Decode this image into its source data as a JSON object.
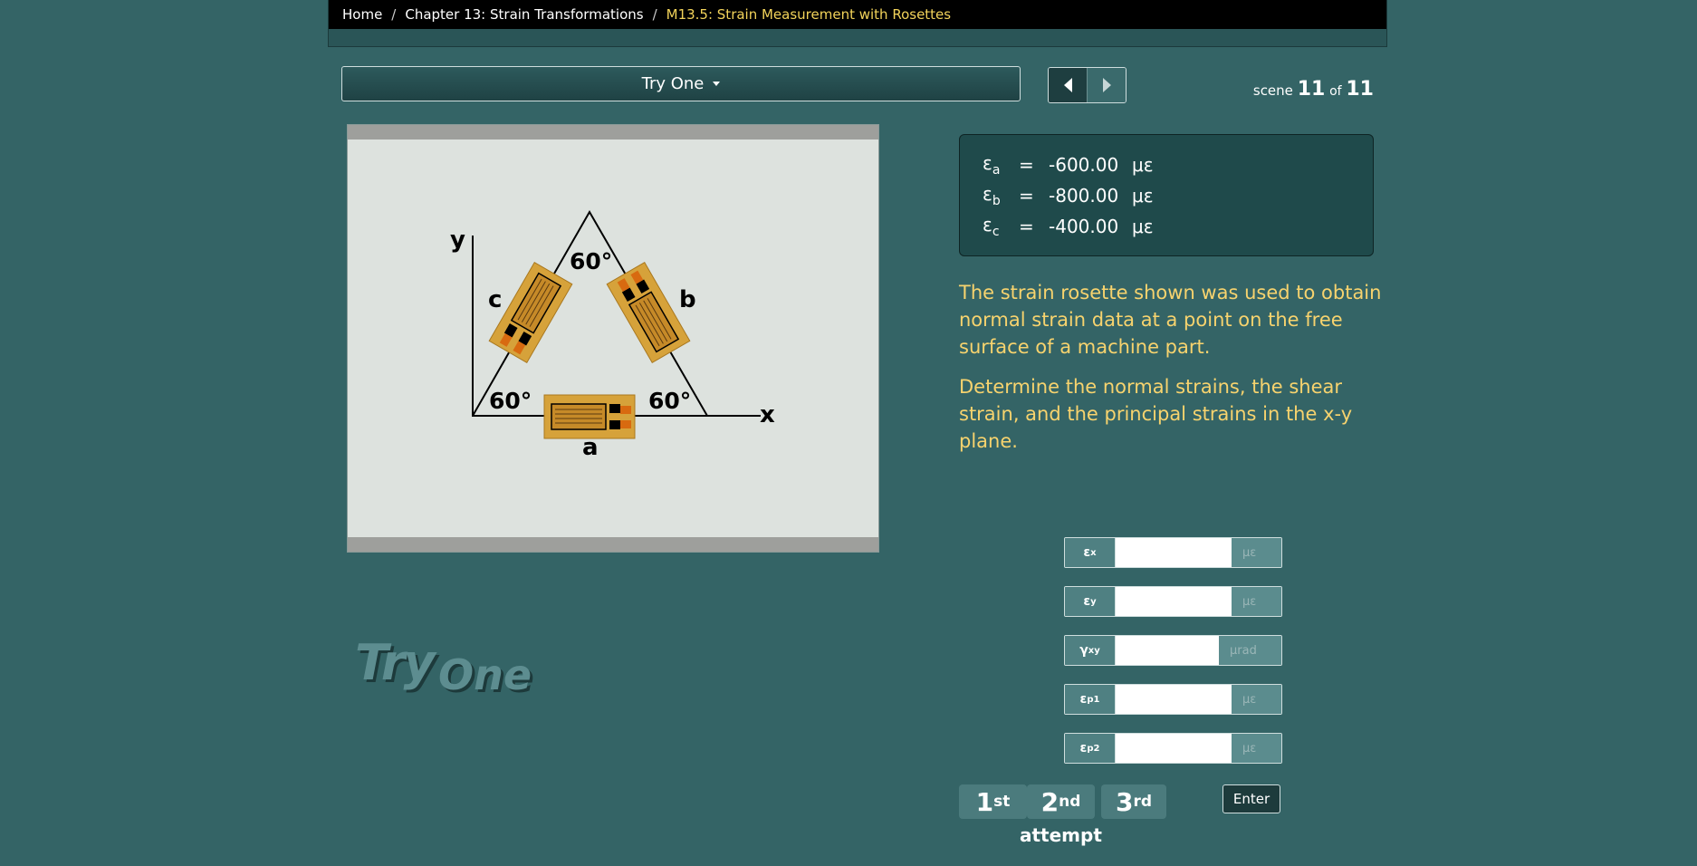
{
  "breadcrumb": {
    "home": "Home",
    "chapter": "Chapter 13: Strain Transformations",
    "current": "M13.5: Strain Measurement with Rosettes"
  },
  "dropdown": {
    "label": "Try One"
  },
  "nav": {
    "prev_icon": "arrow-left-icon",
    "next_icon": "arrow-right-icon"
  },
  "scene": {
    "prefix": "scene",
    "current": "11",
    "of": "of",
    "total": "11"
  },
  "figure": {
    "axis_x": "x",
    "axis_y": "y",
    "angle_top": "60°",
    "angle_left": "60°",
    "angle_right": "60°",
    "gauge_a": "a",
    "gauge_b": "b",
    "gauge_c": "c"
  },
  "logo": {
    "word1": "Try",
    "word2": "One"
  },
  "strains": [
    {
      "symbol": "ε",
      "sub": "a",
      "eq": "=",
      "value": "-600.00",
      "unit": "με"
    },
    {
      "symbol": "ε",
      "sub": "b",
      "eq": "=",
      "value": "-800.00",
      "unit": "με"
    },
    {
      "symbol": "ε",
      "sub": "c",
      "eq": "=",
      "value": "-400.00",
      "unit": "με"
    }
  ],
  "problem": {
    "p1": "The strain rosette shown was used to obtain normal strain data at a point on the free surface of a machine part.",
    "p2": "Determine the normal strains, the shear strain, and the principal strains in the x-y plane."
  },
  "answers": [
    {
      "symbol": "ε",
      "sub": "x",
      "value": "",
      "unit": "με"
    },
    {
      "symbol": "ε",
      "sub": "y",
      "value": "",
      "unit": "με"
    },
    {
      "symbol": "γ",
      "sub": "xy",
      "value": "",
      "unit": "μrad"
    },
    {
      "symbol": "ε",
      "sub": "p1",
      "value": "",
      "unit": "με"
    },
    {
      "symbol": "ε",
      "sub": "p2",
      "value": "",
      "unit": "με"
    }
  ],
  "attempts": [
    {
      "num": "1",
      "suffix": "st"
    },
    {
      "num": "2",
      "suffix": "nd"
    },
    {
      "num": "3",
      "suffix": "rd"
    }
  ],
  "attempt_label": "attempt",
  "enter_label": "Enter",
  "colors": {
    "background": "#346466",
    "accent_text": "#f7d36e",
    "breadcrumb_current": "#f2d35a"
  }
}
